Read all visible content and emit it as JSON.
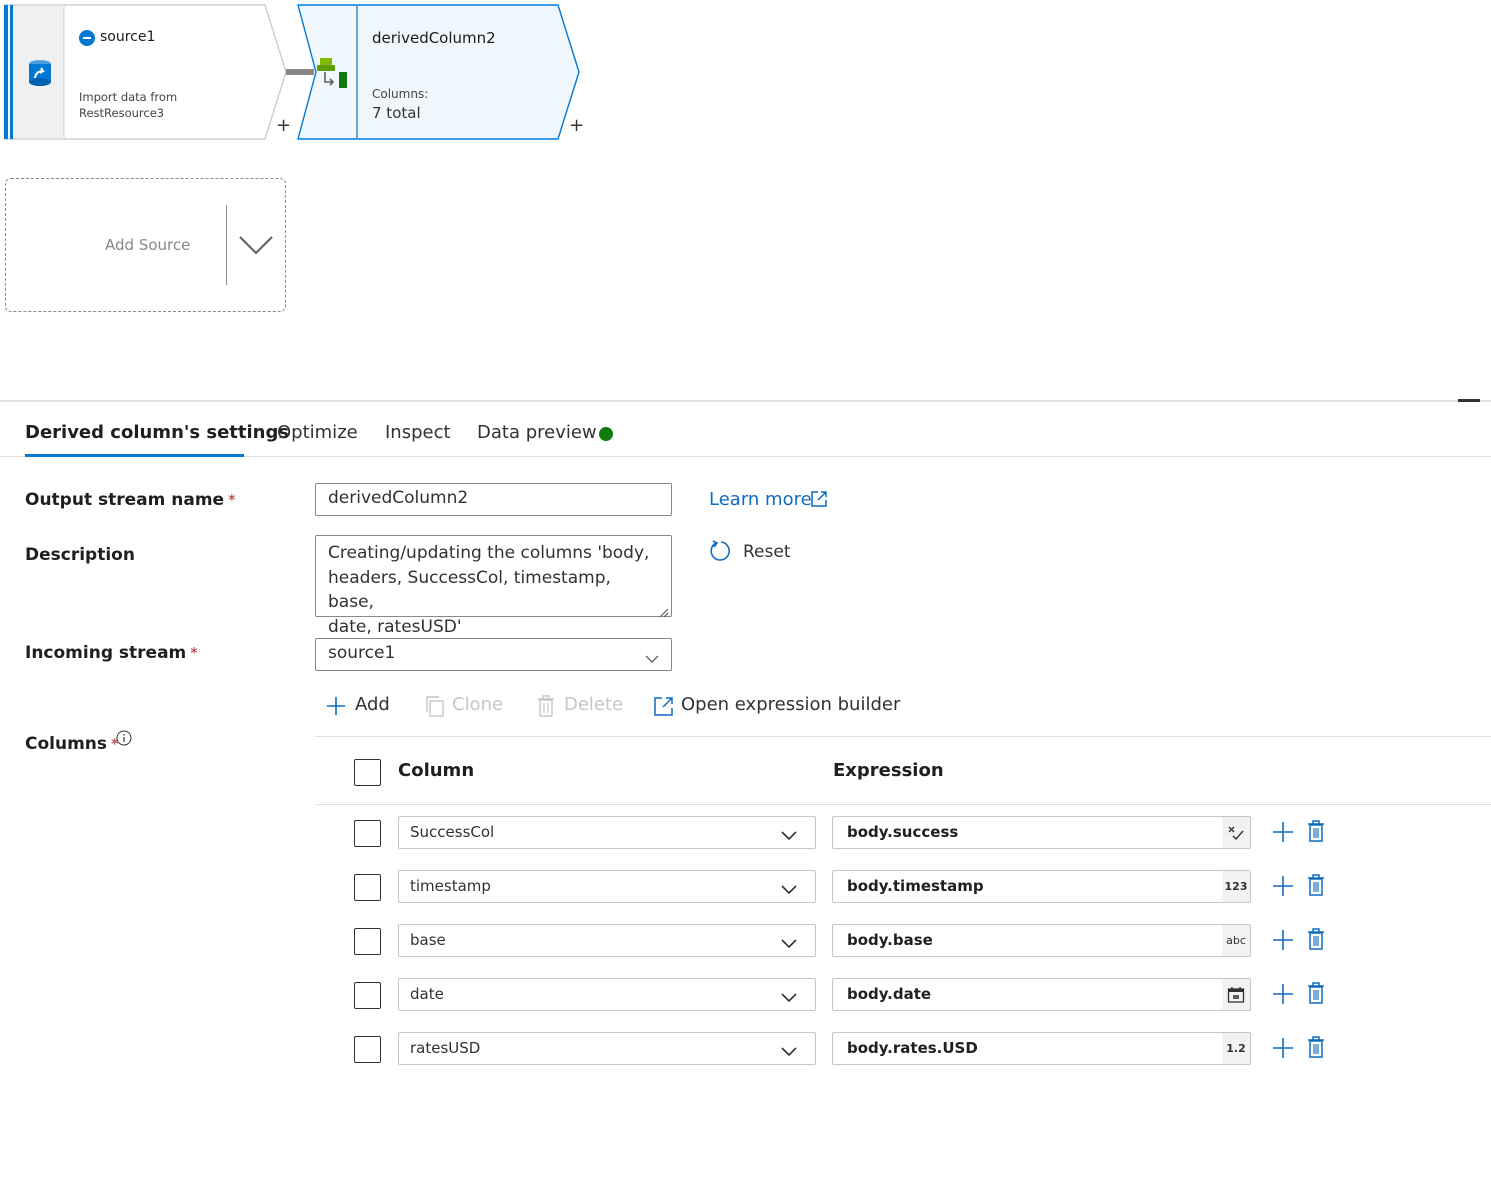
{
  "canvas": {
    "source_node": {
      "title": "source1",
      "subtitle_line1": "Import data from",
      "subtitle_line2": "RestResource3"
    },
    "derived_node": {
      "title": "derivedColumn2",
      "columns_label": "Columns:",
      "columns_value": "7 total"
    },
    "add_source_label": "Add Source",
    "plus_glyph": "+"
  },
  "tabs": [
    {
      "label": "Derived column's settings",
      "active": true
    },
    {
      "label": "Optimize",
      "active": false
    },
    {
      "label": "Inspect",
      "active": false
    },
    {
      "label": "Data preview",
      "active": false
    }
  ],
  "form": {
    "output_stream_label": "Output stream name",
    "output_stream_value": "derivedColumn2",
    "description_label": "Description",
    "description_value": "Creating/updating the columns 'body,\nheaders, SuccessCol, timestamp, base,\ndate, ratesUSD'",
    "incoming_stream_label": "Incoming stream",
    "incoming_stream_value": "source1",
    "columns_label": "Columns",
    "required_mark": "*",
    "learn_more": "Learn more",
    "reset": "Reset"
  },
  "toolbar": {
    "add": "Add",
    "clone": "Clone",
    "delete": "Delete",
    "open_builder": "Open expression builder"
  },
  "table": {
    "header_column": "Column",
    "header_expression": "Expression",
    "rows": [
      {
        "column": "SuccessCol",
        "expression": "body.success",
        "type": "boolean-icon"
      },
      {
        "column": "timestamp",
        "expression": "body.timestamp",
        "type_label": "123"
      },
      {
        "column": "base",
        "expression": "body.base",
        "type_label": "abc"
      },
      {
        "column": "date",
        "expression": "body.date",
        "type": "calendar-icon"
      },
      {
        "column": "ratesUSD",
        "expression": "body.rates.USD",
        "type_label": "1.2"
      }
    ]
  },
  "colors": {
    "accent": "#0078d4",
    "link": "#0f6cbd",
    "status_ok": "#107c10",
    "required": "#a4262c"
  }
}
